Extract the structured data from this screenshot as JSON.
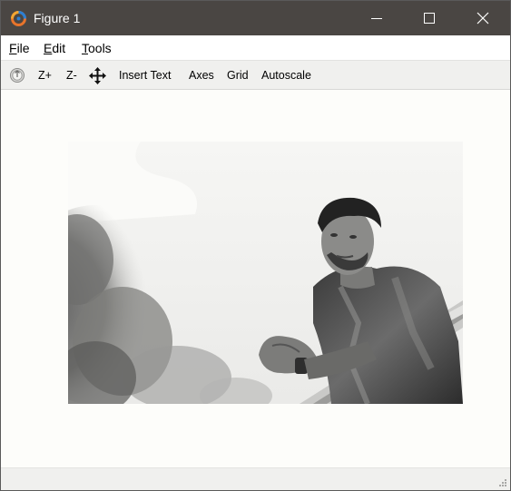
{
  "window": {
    "title": "Figure 1",
    "app_icon": "octave-logo-icon",
    "controls": {
      "minimize": "minimize-icon",
      "maximize": "maximize-icon",
      "close": "close-icon"
    }
  },
  "menu": [
    {
      "label_first": "F",
      "label_rest": "ile"
    },
    {
      "label_first": "E",
      "label_rest": "dit"
    },
    {
      "label_first": "T",
      "label_rest": "ools"
    }
  ],
  "toolbar": {
    "rotate_icon": "rotate-icon",
    "zoom_in": "Z+",
    "zoom_out": "Z-",
    "pan_icon": "pan-move-icon",
    "insert_text": "Insert Text",
    "axes": "Axes",
    "grid": "Grid",
    "autoscale": "Autoscale"
  },
  "canvas": {
    "image_kind": "grayscale photograph of a young man leaning on a railing with trees in the background"
  },
  "colors": {
    "titlebar": "#4a4643",
    "toolbar": "#f0f0ee",
    "canvas": "#fdfdfa"
  }
}
